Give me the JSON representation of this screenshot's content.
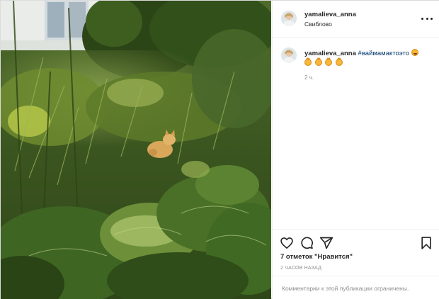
{
  "post": {
    "username": "yamalieva_anna",
    "location": "Свиблово",
    "photo_icon": "photo-of-cat-in-garden",
    "more_icon": "more-options-icon"
  },
  "caption": {
    "username": "yamalieva_anna",
    "hashtag": "#ваймамактоэто",
    "emoji": [
      "laughing-face",
      "cat-face",
      "cat-face",
      "cat-face",
      "cat-face"
    ],
    "time": "2 ч."
  },
  "actions": {
    "icons": [
      "heart-icon",
      "comment-icon",
      "share-icon",
      "bookmark-icon"
    ],
    "likes": "7 отметок \"Нравится\"",
    "posted_ago": "2 ЧАСОВ НАЗАД",
    "comments_closed": "Комментарии к этой публикации ограничены."
  },
  "colors": {
    "border": "#dbdbdb",
    "hashtag": "#00376b",
    "muted": "#8e8e8e",
    "text": "#262626"
  }
}
